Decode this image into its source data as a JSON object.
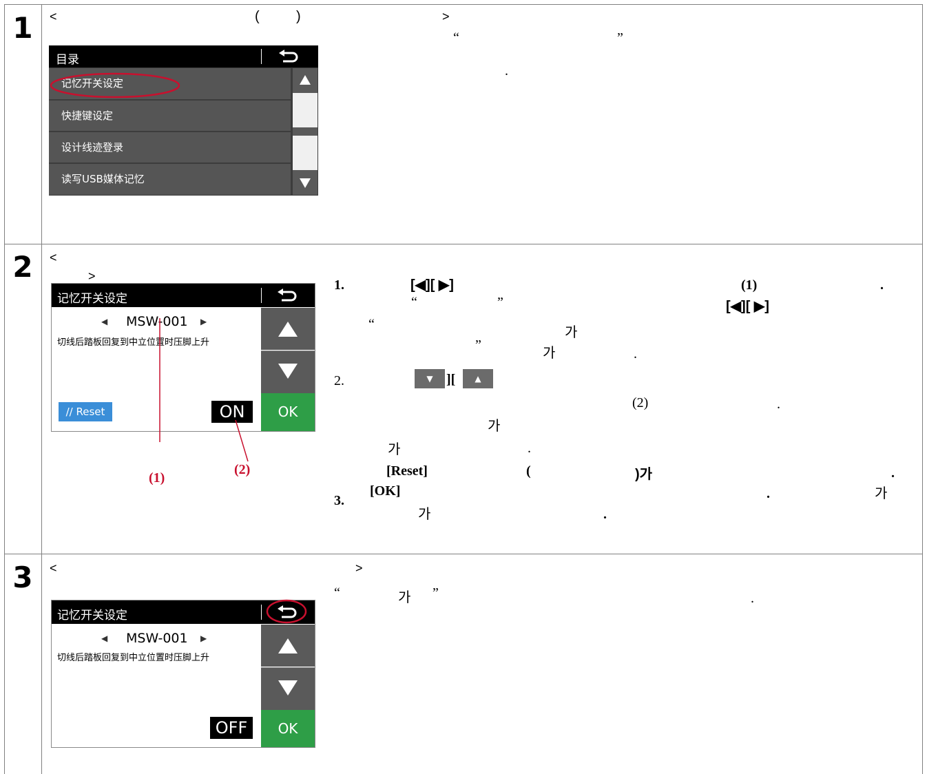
{
  "colors": {
    "accent_red": "#c8102e",
    "ok_green": "#2e9e47",
    "reset_blue": "#3a8ed8",
    "menu_gray": "#555555"
  },
  "steps": [
    {
      "number": "1",
      "header_lt": "<",
      "header_paren_open": "(",
      "header_paren_close": ")",
      "header_gt": ">",
      "right_quote_open": "“",
      "right_quote_close": "”",
      "right_period": ".",
      "menu": {
        "title": "目录",
        "back_icon": "back-arrow-icon",
        "items": [
          "记忆开关设定",
          "快捷键设定",
          "设计线迹登录",
          "读写USB媒体记忆"
        ]
      }
    },
    {
      "number": "2",
      "header_lt": "<",
      "header_gt": ">",
      "screen": {
        "title": "记忆开关设定",
        "code": "MSW-001",
        "description": "切线后踏板回复到中立位置时压脚上升",
        "reset_label": "Reset",
        "toggle_value": "ON",
        "ok_label": "OK"
      },
      "callout_1": "(1)",
      "callout_2": "(2)",
      "instructions": {
        "item1_num": "1.",
        "item1_keys": "[◀][ ▶]",
        "item1_ref": "(1)",
        "item1_period": ".",
        "item1_quote_open": "“",
        "item1_quote_close": "”",
        "item1_keys2": "[◀][ ▶]",
        "item1_line3_quote": "“",
        "item1_line3_ga": "가",
        "item1_line4_quote": "”",
        "item1_line4_ga": "가",
        "item1_line4_period": ".",
        "item2_num": "2.",
        "item2_sep": "][",
        "item2_ref": "(2)",
        "item2_period": ".",
        "item2_line2_ga": "가",
        "item2_line3_ga": "가",
        "item2_line3_period": ".",
        "item2_reset": "[Reset]",
        "item2_paren_open": "(",
        "item2_paren_close_ga": ")가",
        "item2_period2": ".",
        "item3_num": "3.",
        "item3_ok": "[OK]",
        "item3_period": ".",
        "item3_ga1": "가",
        "item3_ga2": "가",
        "item3_period2": "."
      }
    },
    {
      "number": "3",
      "header_lt": "<",
      "header_gt": ">",
      "right_quote_open": "“",
      "right_ga": "가",
      "right_quote_close": "”",
      "right_period": ".",
      "screen": {
        "title": "记忆开关设定",
        "code": "MSW-001",
        "description": "切线后踏板回复到中立位置时压脚上升",
        "toggle_value": "OFF",
        "ok_label": "OK"
      }
    }
  ]
}
